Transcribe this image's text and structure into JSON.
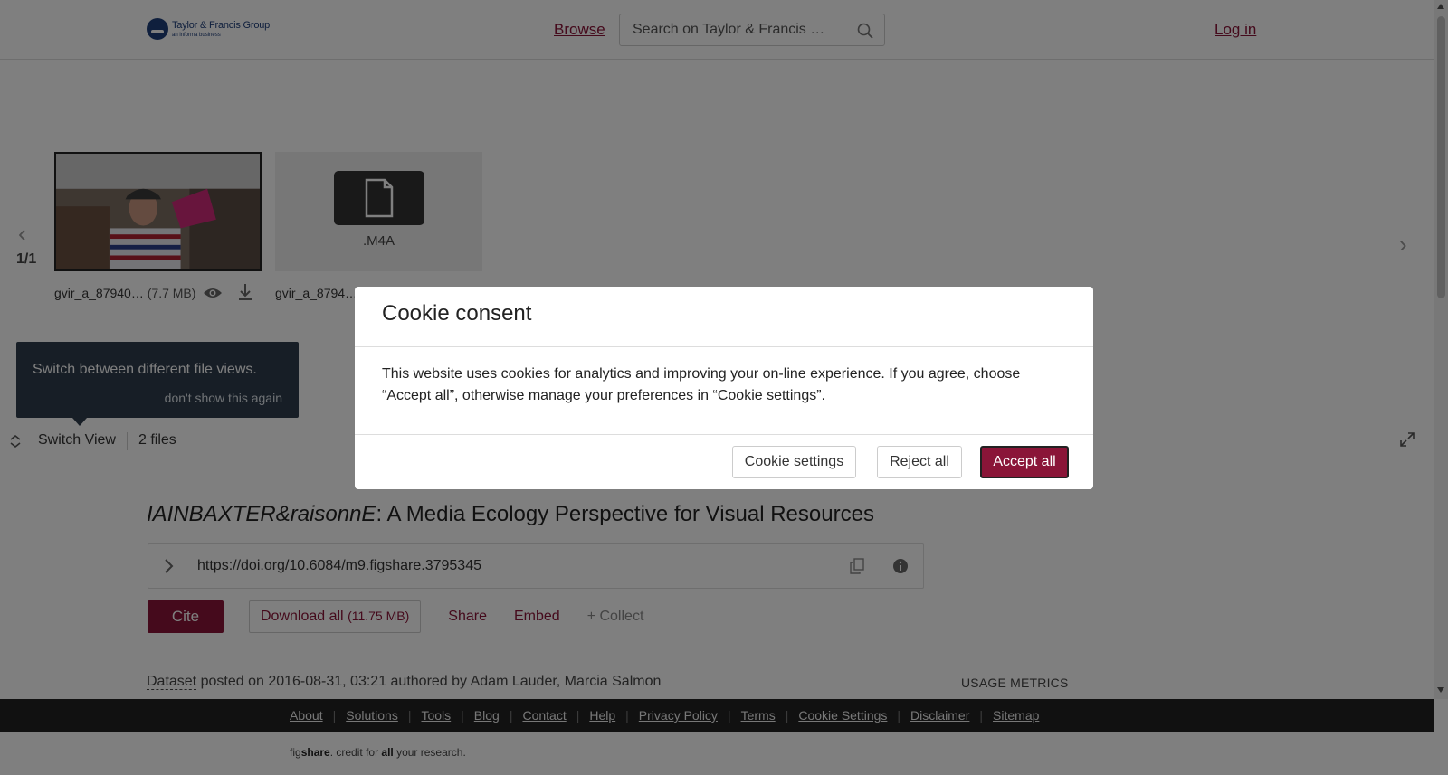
{
  "header": {
    "logo_line1": "Taylor & Francis Group",
    "logo_line2": "an informa business",
    "browse_label": "Browse",
    "search_placeholder": "Search on Taylor & Francis …",
    "login_label": "Log in"
  },
  "viewer": {
    "pager": "1/1",
    "files": [
      {
        "name": "gvir_a_87940…",
        "size": "(7.7 MB)",
        "kind": "video-thumbnail"
      },
      {
        "name": "gvir_a_8794…",
        "extension": ".M4A",
        "kind": "generic-file"
      }
    ],
    "tooltip": {
      "text": "Switch between different file views.",
      "dismiss": "don't show this again"
    },
    "switch_view_label": "Switch View",
    "files_count": "2 files"
  },
  "article": {
    "title_italic": "IAINBAXTER&raisonnE",
    "title_rest": ": A Media Ecology Perspective for Visual Resources",
    "doi": "https://doi.org/10.6084/m9.figshare.3795345",
    "cite_label": "Cite",
    "download_label": "Download all",
    "download_size": "(11.75 MB)",
    "share_label": "Share",
    "embed_label": "Embed",
    "collect_label": "+ Collect",
    "item_type": "Dataset",
    "meta_text": " posted on 2016-08-31, 03:21 authored by Adam Lauder, Marcia Salmon",
    "usage_metrics": "USAGE METRICS"
  },
  "footer": {
    "links": [
      "About",
      "Solutions",
      "Tools",
      "Blog",
      "Contact",
      "Help",
      "Privacy Policy",
      "Terms",
      "Cookie Settings",
      "Disclaimer",
      "Sitemap"
    ],
    "tag_fig": "fig",
    "tag_share": "share",
    "tag_mid": ". credit for ",
    "tag_all": "all",
    "tag_end": " your research."
  },
  "cookie_modal": {
    "title": "Cookie consent",
    "body": "This website uses cookies for analytics and improving your on-line experience. If you agree, choose “Accept all”, otherwise manage your preferences in “Cookie settings”.",
    "settings_label": "Cookie settings",
    "reject_label": "Reject all",
    "accept_label": "Accept all"
  },
  "colors": {
    "brand": "#8a1538",
    "overlay": "rgba(0,0,0,0.5)",
    "footer_bg": "#222222",
    "tooltip_bg": "#2e3d4c"
  }
}
